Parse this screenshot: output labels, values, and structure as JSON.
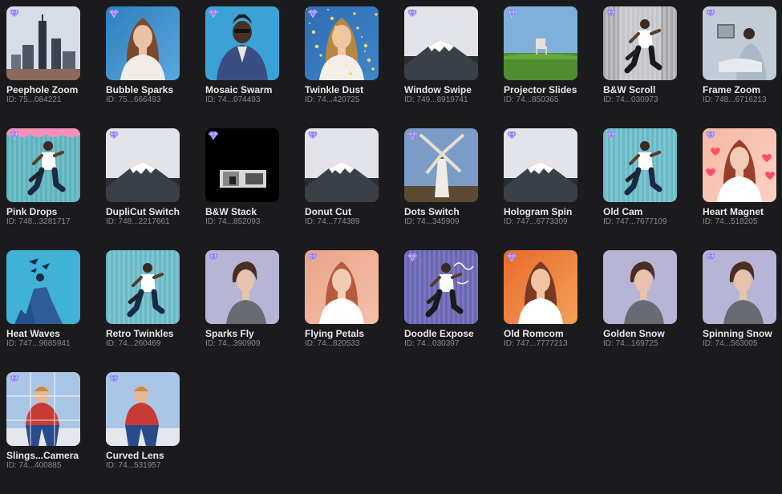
{
  "colors": {
    "background": "#1b1b1d",
    "title": "#e8e8ea",
    "id": "#8a8a90",
    "premium_badge": "#8e7cf4"
  },
  "effects": [
    {
      "name": "Peephole Zoom",
      "id": "ID: 75...084221",
      "thumb": "city",
      "premium": true
    },
    {
      "name": "Bubble Sparks",
      "id": "ID: 75...666493",
      "thumb": "woman-blue",
      "premium": true
    },
    {
      "name": "Mosaic Swarm",
      "id": "ID: 74...074493",
      "thumb": "man-blue",
      "premium": true
    },
    {
      "name": "Twinkle Dust",
      "id": "ID: 74...420725",
      "thumb": "woman-sparkle",
      "premium": true
    },
    {
      "name": "Window Swipe",
      "id": "ID: 749...8919741",
      "thumb": "mountain",
      "premium": true
    },
    {
      "name": "Projector Slides",
      "id": "ID: 74...850365",
      "thumb": "field-chair",
      "premium": true
    },
    {
      "name": "B&W Scroll",
      "id": "ID: 74...030973",
      "thumb": "skater-bw",
      "premium": true
    },
    {
      "name": "Frame Zoom",
      "id": "ID: 748...6716213",
      "thumb": "frame-zoom",
      "premium": true
    },
    {
      "name": "Pink Drops",
      "id": "ID: 748...3281717",
      "thumb": "skater-pink",
      "premium": true
    },
    {
      "name": "DupliCut Switch",
      "id": "ID: 748...2217661",
      "thumb": "mountain",
      "premium": true
    },
    {
      "name": "B&W Stack",
      "id": "ID: 74...852093",
      "thumb": "bw-stack",
      "premium": true
    },
    {
      "name": "Donut Cut",
      "id": "ID: 74...774389",
      "thumb": "mountain",
      "premium": true
    },
    {
      "name": "Dots Switch",
      "id": "ID: 74...345909",
      "thumb": "windmill",
      "premium": true
    },
    {
      "name": "Hologram Spin",
      "id": "ID: 747...6773309",
      "thumb": "mountain",
      "premium": true
    },
    {
      "name": "Old Cam",
      "id": "ID: 747...7677109",
      "thumb": "skater",
      "premium": true
    },
    {
      "name": "Heart Magnet",
      "id": "ID: 74...518205",
      "thumb": "woman-hearts",
      "premium": true
    },
    {
      "name": "Heat Waves",
      "id": "ID: 747...9685941",
      "thumb": "heat-waves",
      "premium": false
    },
    {
      "name": "Retro Twinkles",
      "id": "ID: 74...260469",
      "thumb": "skater",
      "premium": false
    },
    {
      "name": "Sparks Fly",
      "id": "ID: 74...390909",
      "thumb": "woman-lavender",
      "premium": true
    },
    {
      "name": "Flying Petals",
      "id": "ID: 74...820533",
      "thumb": "woman-peach",
      "premium": true
    },
    {
      "name": "Doodle Expose",
      "id": "ID: 74...030397",
      "thumb": "skater-doodle",
      "premium": true
    },
    {
      "name": "Old Romcom",
      "id": "ID: 747...7777213",
      "thumb": "woman-orange",
      "premium": true
    },
    {
      "name": "Golden Snow",
      "id": "ID: 74...169725",
      "thumb": "woman-lavender",
      "premium": false
    },
    {
      "name": "Spinning Snow",
      "id": "ID: 74...563005",
      "thumb": "woman-lavender",
      "premium": true
    },
    {
      "name": "Slings...Camera",
      "id": "ID: 74...400885",
      "thumb": "boy-grid",
      "premium": true
    },
    {
      "name": "Curved Lens",
      "id": "ID: 74...531957",
      "thumb": "boy",
      "premium": true
    }
  ]
}
